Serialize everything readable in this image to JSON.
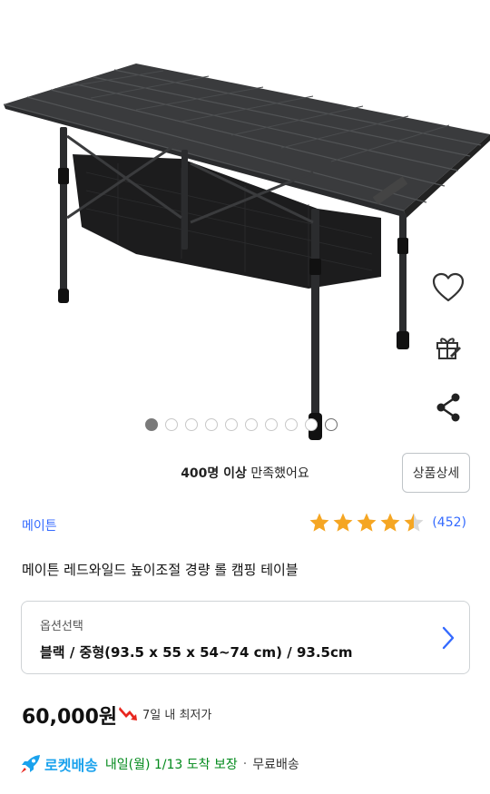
{
  "gallery": {
    "page_count": 10,
    "current_index": 9,
    "active_index": 0
  },
  "side_actions": {
    "wishlist_icon": "heart-outline-icon",
    "gift_icon": "gift-icon",
    "share_icon": "share-icon"
  },
  "satisfaction": {
    "emphasis": "400명 이상",
    "rest": "만족했어요"
  },
  "detail_button": {
    "label": "상품상세"
  },
  "product": {
    "brand": "메이튼",
    "title": "메이튼 레드와일드 높이조절 경량 롤 캠핑 테이블",
    "rating": 4.5,
    "review_count": "(452)",
    "star_color": "#f5a623"
  },
  "option": {
    "label": "옵션선택",
    "value": "블랙 / 중형(93.5 x 55 x 54~74 cm) / 93.5cm"
  },
  "price": {
    "amount": "60,000원",
    "note": "7일 내 최저가",
    "note_icon": "price-drop-arrow-icon"
  },
  "delivery": {
    "icon": "rocket-icon",
    "label": "로켓배송",
    "arrival": "내일(월) 1/13 도착 보장",
    "separator": "·",
    "shipping": "무료배송"
  },
  "colors": {
    "accent_blue": "#346aff",
    "rocket_blue": "#1aa2ed",
    "arrival_green": "#00891a",
    "price_arrow_red": "#e8261e"
  }
}
